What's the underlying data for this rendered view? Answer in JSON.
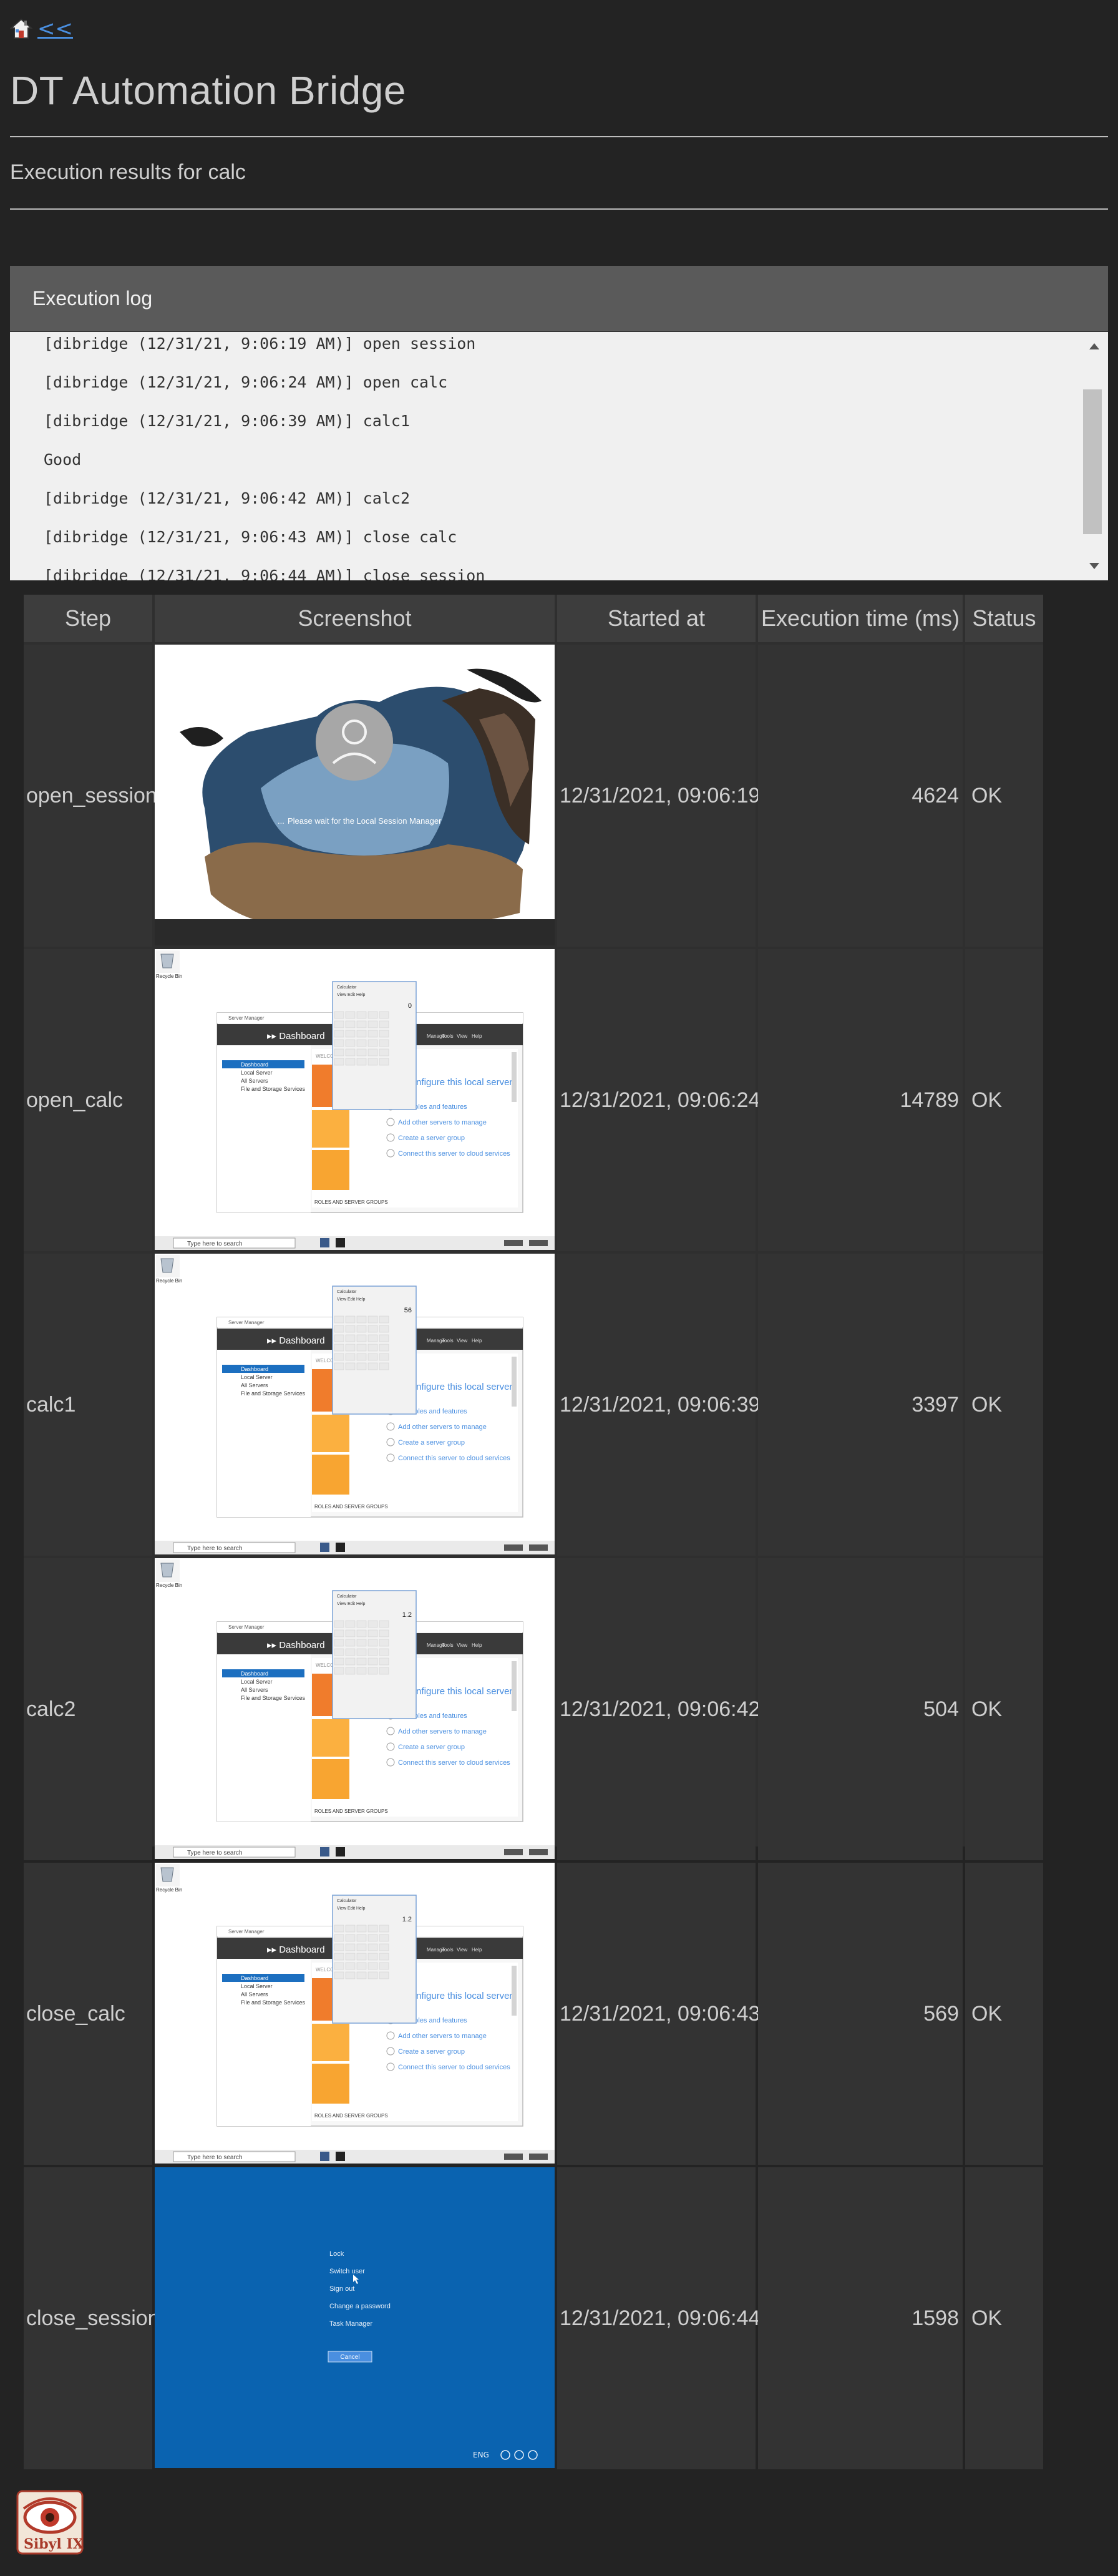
{
  "nav": {
    "home_icon": "home-icon",
    "back_label": "<<"
  },
  "page": {
    "title": "DT Automation Bridge",
    "subtitle": "Execution results for calc"
  },
  "log": {
    "header": "Execution log",
    "lines": [
      "[dibridge (12/31/21, 9:06:19 AM)] open session",
      "[dibridge (12/31/21, 9:06:24 AM)] open calc",
      "[dibridge (12/31/21, 9:06:39 AM)] calc1",
      "Good",
      "[dibridge (12/31/21, 9:06:42 AM)] calc2",
      "[dibridge (12/31/21, 9:06:43 AM)] close calc",
      "[dibridge (12/31/21, 9:06:44 AM)] close session"
    ]
  },
  "table": {
    "headers": [
      "Step",
      "Screenshot",
      "Started at",
      "Execution time (ms)",
      "Status"
    ],
    "rows": [
      {
        "step": "open_session",
        "started": "12/31/2021, 09:06:19",
        "exec": "4624",
        "status": "OK",
        "shot": "login"
      },
      {
        "step": "open_calc",
        "started": "12/31/2021, 09:06:24",
        "exec": "14789",
        "status": "OK",
        "shot": "desktop",
        "display": "0"
      },
      {
        "step": "calc1",
        "started": "12/31/2021, 09:06:39",
        "exec": "3397",
        "status": "OK",
        "shot": "desktop",
        "display": "56"
      },
      {
        "step": "calc2",
        "started": "12/31/2021, 09:06:42",
        "exec": "504",
        "status": "OK",
        "shot": "desktop",
        "display": "1.2"
      },
      {
        "step": "close_calc",
        "started": "12/31/2021, 09:06:43",
        "exec": "569",
        "status": "OK",
        "shot": "desktop",
        "display": "1.2"
      },
      {
        "step": "close_session",
        "started": "12/31/2021, 09:06:44",
        "exec": "1598",
        "status": "OK",
        "shot": "ctrl-alt-del"
      }
    ]
  },
  "screenshot_text": {
    "login_wait": "Please wait for the Local Session Manager",
    "dashboard": "Dashboard",
    "welcome": "WELCOME",
    "configure": "Configure this local server",
    "server_manager": "Server Manager",
    "sidebar": [
      "Dashboard",
      "Local Server",
      "All Servers",
      "File and Storage Services"
    ],
    "menu": [
      "Manage",
      "Tools",
      "View",
      "Help"
    ],
    "tasks": [
      "Add roles and features",
      "Add other servers to manage",
      "Create a server group",
      "Connect this server to cloud services"
    ],
    "roles": "ROLES AND SERVER GROUPS",
    "search": "Type here to search",
    "calc_title": "Calculator",
    "calc_menu": [
      "View",
      "Edit",
      "Help"
    ],
    "recycle": "Recycle Bin",
    "cad_options": [
      "Lock",
      "Switch user",
      "Sign out",
      "Change a password",
      "Task Manager"
    ],
    "cancel": "Cancel"
  },
  "logo": {
    "text": "Sibyl IX",
    "icon": "eye-logo-icon"
  },
  "colors": {
    "accent_link": "#4a8fe0",
    "desktop_blue": "#0a63b0",
    "orange": "#f07c2c"
  }
}
